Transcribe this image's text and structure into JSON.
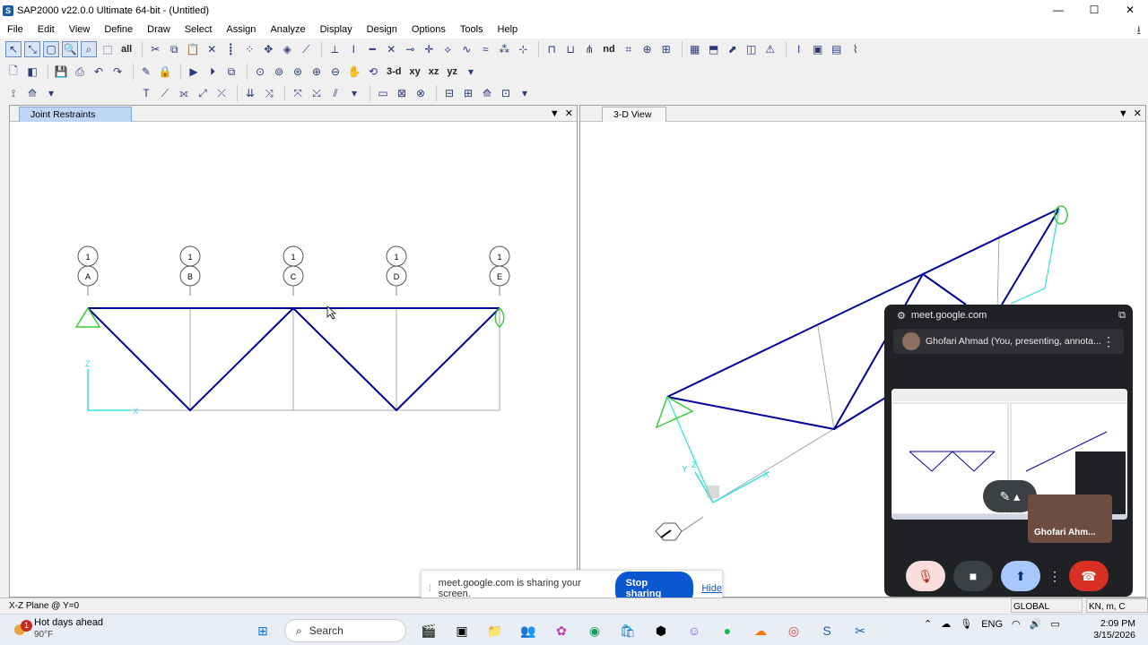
{
  "window": {
    "title": "SAP2000 v22.0.0 Ultimate 64-bit - (Untitled)",
    "app_icon": "S",
    "minimize": "—",
    "maximize": "☐",
    "close": "✕"
  },
  "menu": [
    "File",
    "Edit",
    "View",
    "Define",
    "Draw",
    "Select",
    "Assign",
    "Analyze",
    "Display",
    "Design",
    "Options",
    "Tools",
    "Help"
  ],
  "toolbar2": {
    "view_3d": "3-d",
    "view_xy": "xy",
    "view_xz": "xz",
    "view_yz": "yz"
  },
  "left_pane": {
    "tab": "Joint Restraints",
    "grid_number": "1",
    "grid_labels": [
      "A",
      "B",
      "C",
      "D",
      "E"
    ],
    "axis_z": "Z",
    "axis_x": "X"
  },
  "right_pane": {
    "tab": "3-D View",
    "axis_y": "Y",
    "axis_z": "Z",
    "axis_x": "X"
  },
  "meet": {
    "url": "meet.google.com",
    "presenter": "Ghofari Ahmad (You, presenting, annota...",
    "self_name": "Ghofari Ahm..."
  },
  "share_banner": {
    "message": "meet.google.com is sharing your screen.",
    "stop": "Stop sharing",
    "hide": "Hide"
  },
  "status": {
    "plane": "X-Z Plane @ Y=0",
    "coord_sys": "GLOBAL",
    "units": "KN, m, C"
  },
  "taskbar": {
    "weather_title": "Hot days ahead",
    "weather_temp": "90°F",
    "weather_badge": "1",
    "search": "Search",
    "lang": "ENG",
    "time": "2:09 PM",
    "date": "3/15/2026"
  },
  "colors": {
    "frame": "#00009a",
    "restraint": "#3ccc3c",
    "axis": "#30e0e0",
    "grid": "#a8a8a8",
    "meet_dark": "#202124",
    "stop_button": "#0b57d0",
    "end_call": "#d93025"
  }
}
